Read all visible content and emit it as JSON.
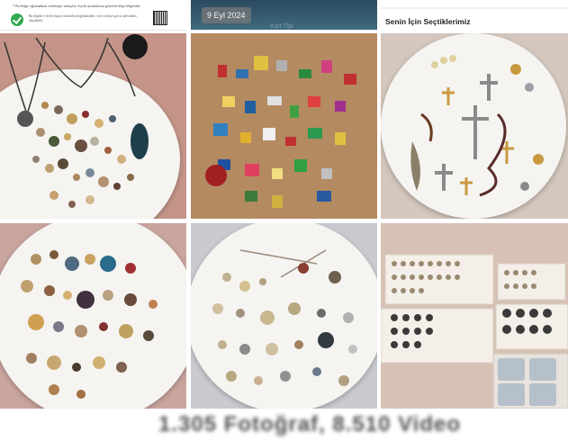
{
  "top_strip": {
    "doc_note": "* Bu belge, uğramaktan verilmiştir sonuçlar, teşvik ayrıntılarını gösteren bilgi belgesidir.",
    "doc_small": "Bu bilgiler e-devlet kapısı üzerinden doğrulanabilir. www.turkiye.gov.tr adresinden ulaşılabilir.",
    "date_badge": "9 Eyl 2024",
    "ghost_text": "Kart Tipi",
    "section_title": "Senin İçin Seçtiklerimiz"
  },
  "gallery": {
    "tiles": [
      {
        "label": "jewelry-brooch-collection-plate"
      },
      {
        "label": "enamel-pin-collection-board"
      },
      {
        "label": "religious-cross-pendants-plate"
      },
      {
        "label": "vintage-brooches-plate"
      },
      {
        "label": "silver-brooches-plate"
      },
      {
        "label": "ring-display-boxes"
      }
    ]
  },
  "footer": {
    "summary": "1.305 Fotoğraf, 8.510 Video"
  },
  "colors": {
    "accent": "#2fa84f",
    "plate": "#f5f4f1",
    "board": "#a8753f"
  }
}
